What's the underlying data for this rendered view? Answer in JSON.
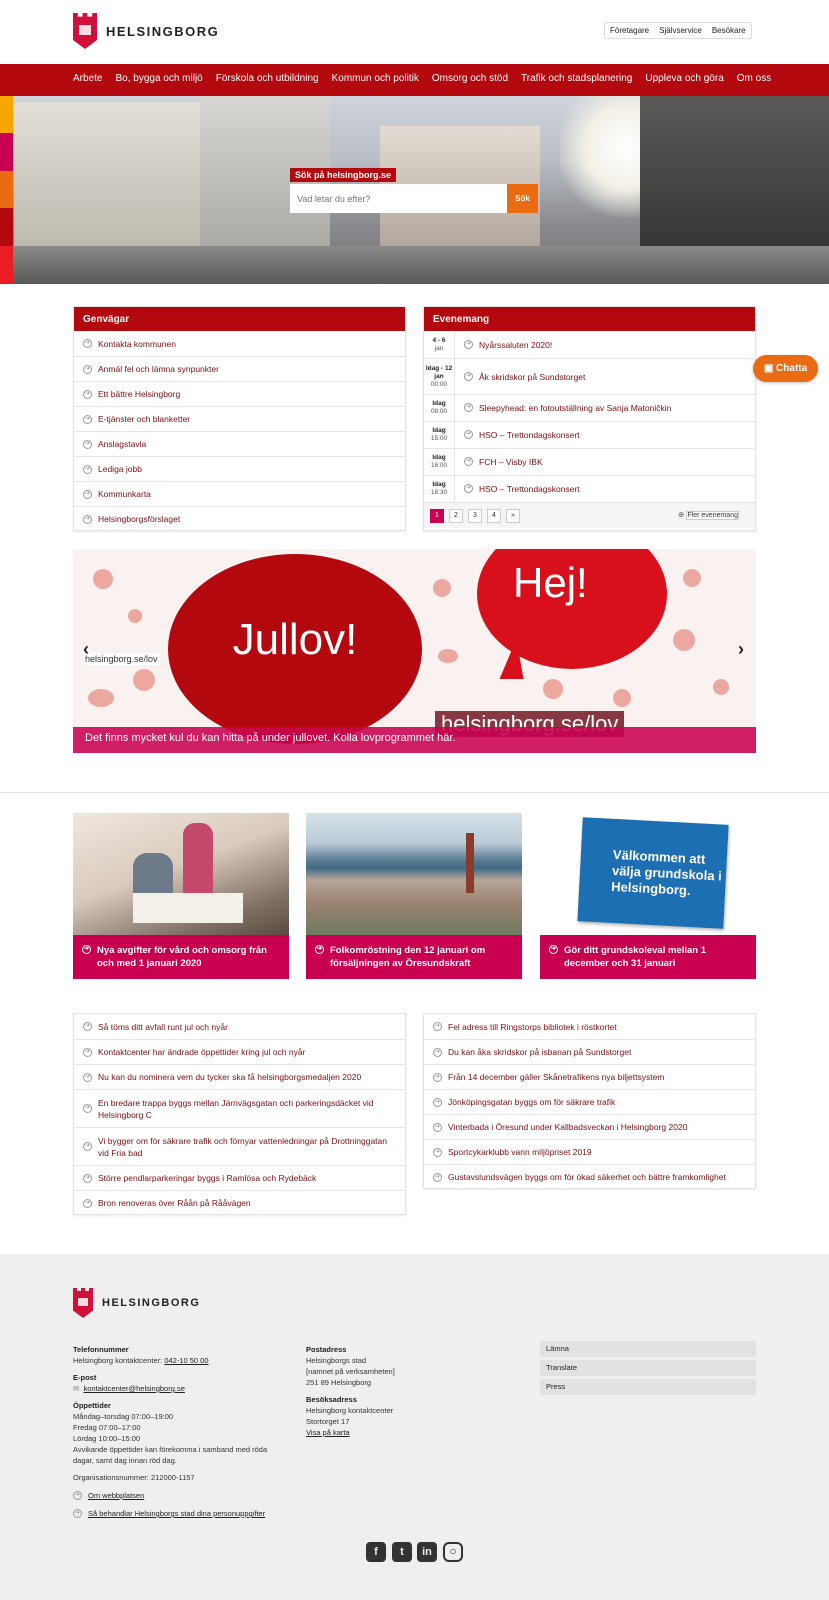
{
  "header": {
    "logo_text": "HELSINGBORG",
    "top_links": [
      "Företagare",
      "Självservice",
      "Besökare"
    ]
  },
  "nav": {
    "items": [
      "Arbete",
      "Bo, bygga och miljö",
      "Förskola och utbildning",
      "Kommun och politik",
      "Omsorg och stöd",
      "Trafik och stadsplanering",
      "Uppleva och göra",
      "Om oss"
    ]
  },
  "hero": {
    "search_label": "Sök på helsingborg.se",
    "search_placeholder": "Vad letar du efter?",
    "search_button": "Sök"
  },
  "colors": {
    "brand_red": "#b3080d",
    "accent_pink": "#c8004f",
    "accent_orange": "#ea6b12",
    "hero_strip": [
      "#f7a600",
      "#c8004f",
      "#ea6b12",
      "#b3080d",
      "#ea1c24"
    ]
  },
  "shortcuts": {
    "title": "Genvägar",
    "items": [
      "Kontakta kommunen",
      "Anmäl fel och lämna synpunkter",
      "Ett bättre Helsingborg",
      "E-tjänster och blanketter",
      "Anslagstavla",
      "Lediga jobb",
      "Kommunkarta",
      "Helsingborgsförslaget"
    ]
  },
  "events": {
    "title": "Evenemang",
    "items": [
      {
        "date": "4 - 6",
        "sub": "jan",
        "title": "Nyårssaluten 2020!"
      },
      {
        "date": "Idag - 12 jan",
        "sub": "00:00",
        "title": "Åk skridskor på Sundstorget"
      },
      {
        "date": "Idag",
        "sub": "08:00",
        "title": "Sleepyhead: en fotoutställning av Sanja Matoničkin"
      },
      {
        "date": "Idag",
        "sub": "15:00",
        "title": "HSO – Trettondagskonsert"
      },
      {
        "date": "Idag",
        "sub": "16:00",
        "title": "FCH – Visby IBK"
      },
      {
        "date": "Idag",
        "sub": "18:30",
        "title": "HSO – Trettondagskonsert"
      }
    ],
    "pages": [
      "1",
      "2",
      "3",
      "4",
      "»"
    ],
    "more": "Fler evenemang"
  },
  "carousel": {
    "bubble_left": "Jullov!",
    "bubble_right": "Hej!",
    "url_big": "helsingborg.se/lov",
    "url_small": "helsingborg.se/lov",
    "caption": "Det finns mycket kul du kan hitta på under jullovet. Kolla lovprogrammet här.",
    "prev": "‹",
    "next": "›"
  },
  "cards": [
    {
      "title": "Nya avgifter för vård och omsorg från och med 1 januari 2020"
    },
    {
      "title": "Folkomröstning den 12 januari om försäljningen av Öresundskraft"
    },
    {
      "title": "Gör ditt grundskoleval mellan 1 december och 31 januari",
      "image_text": "Välkommen att välja grundskola i Helsingborg."
    }
  ],
  "news_left": [
    "Så töms ditt avfall runt jul och nyår",
    "Kontaktcenter har ändrade öppettider kring jul och nyår",
    "Nu kan du nominera vem du tycker ska få helsingborgsmedaljen 2020",
    "En bredare trappa byggs mellan Järnvägsgatan och parkeringsdäcket vid Helsingborg C",
    "Vi bygger om för säkrare trafik och förnyar vattenledningar på Drottninggatan vid Fria bad",
    "Större pendlarparkeringar byggs i Ramlösa och Rydebäck",
    "Bron renoveras över Råån på Rååvägen"
  ],
  "news_right": [
    "Fel adress till Ringstorps bibliotek i röstkortet",
    "Du kan åka skridskor på isbanan på Sundstorget",
    "Från 14 december gäller Skånetrafikens nya biljettsystem",
    "Jönköpingsgatan byggs om för säkrare trafik",
    "Vinterbada i Öresund under Kallbadsveckan i Helsingborg 2020",
    "Sportcykarklubb vann miljöpriset 2019",
    "Gustavslundsvägen byggs om för ökad säkerhet och bättre framkomlighet"
  ],
  "footer": {
    "logo_text": "HELSINGBORG",
    "phone_label": "Telefonnummer",
    "phone_text": "Helsingborg kontaktcenter:",
    "phone_number": "042-10 50 00",
    "email_label": "E-post",
    "email": "kontaktcenter@helsingborg.se",
    "hours_label": "Öppettider",
    "hours": [
      "Måndag–torsdag 07:00–19:00",
      "Fredag 07:00–17:00",
      "Lördag 10:00–15:00",
      "Avvikande öppettider kan förekomma i samband med röda",
      "dagar, samt dag innan röd dag."
    ],
    "org_number": "Organisationsnummer: 212000-1157",
    "about_link": "Om webbplatsen",
    "privacy_link": "Så behandlar Helsingborgs stad dina personuppgifter",
    "postal_label": "Postadress",
    "postal": [
      "Helsingborgs stad",
      "[namnet på verksamheten]",
      "251 89 Helsingborg"
    ],
    "visit_label": "Besöksadress",
    "visit": [
      "Helsingborg kontaktcenter",
      "Stortorget 17"
    ],
    "map_link": "Visa på karta",
    "buttons": [
      "Lämna",
      "Translate",
      "Press"
    ],
    "social": [
      "facebook-icon",
      "twitter-icon",
      "linkedin-icon",
      "instagram-icon"
    ]
  },
  "chat": {
    "label": "Chatta"
  }
}
